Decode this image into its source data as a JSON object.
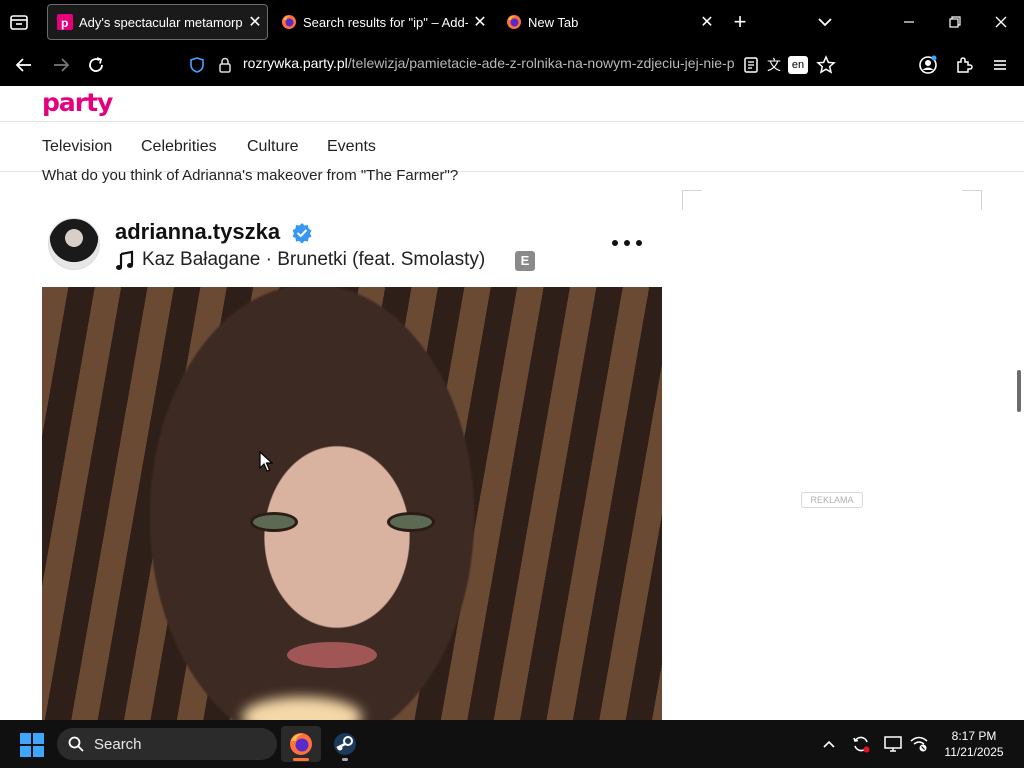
{
  "browser": {
    "tabs": [
      {
        "title": "Ady's spectacular metamorphosis",
        "active": true,
        "favicon": "party-favicon"
      },
      {
        "title": "Search results for \"ip\" – Add-ons",
        "active": false,
        "favicon": "firefox-favicon"
      },
      {
        "title": "New Tab",
        "active": false,
        "favicon": "firefox-favicon"
      }
    ],
    "url_host": "rozrywka.party.pl",
    "url_path": "/telewizja/pamietacie-ade-z-rolnika-na-nowym-zdjeciu-jej-nie-p",
    "translate_lang": "en"
  },
  "site": {
    "logo": "party",
    "brand_color": "#e6007e",
    "nav": [
      "Television",
      "Celebrities",
      "Culture",
      "Events"
    ]
  },
  "article": {
    "question": "What do you think of Adrianna's makeover from \"The Farmer\"?"
  },
  "instagram_embed": {
    "username": "adrianna.tyszka",
    "verified": true,
    "song": "Kaz Bałagane · Brunetki (feat. Smolasty)",
    "explicit_badge": "E"
  },
  "ad": {
    "label": "REKLAMA"
  },
  "taskbar": {
    "search_label": "Search",
    "time": "8:17 PM",
    "date": "11/21/2025"
  }
}
